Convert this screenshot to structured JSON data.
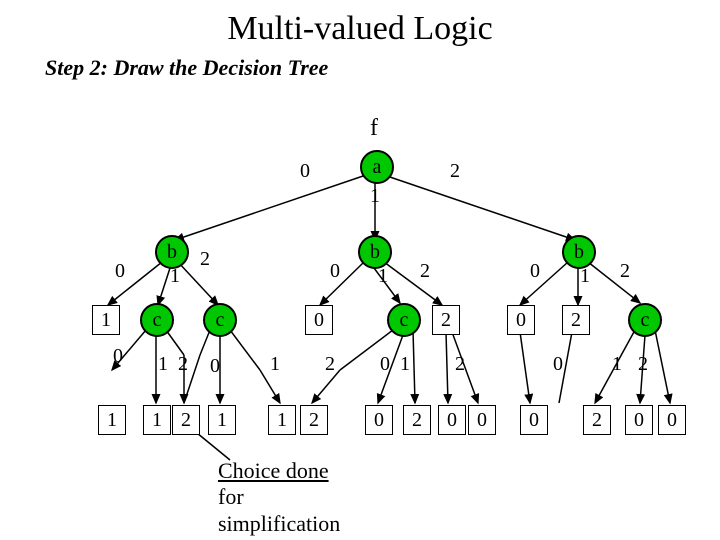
{
  "title": "Multi-valued Logic",
  "subtitle": "Step 2: Draw the Decision Tree",
  "root_label": "f",
  "nodes": {
    "a": "a",
    "b": "b",
    "c": "c"
  },
  "edge_labels": {
    "e0": "0",
    "e1": "1",
    "e2": "2"
  },
  "leaves": {
    "l1": "1",
    "l2": "2",
    "l0": "0"
  },
  "annotation": "Choice done\nfor\nsimplification"
}
